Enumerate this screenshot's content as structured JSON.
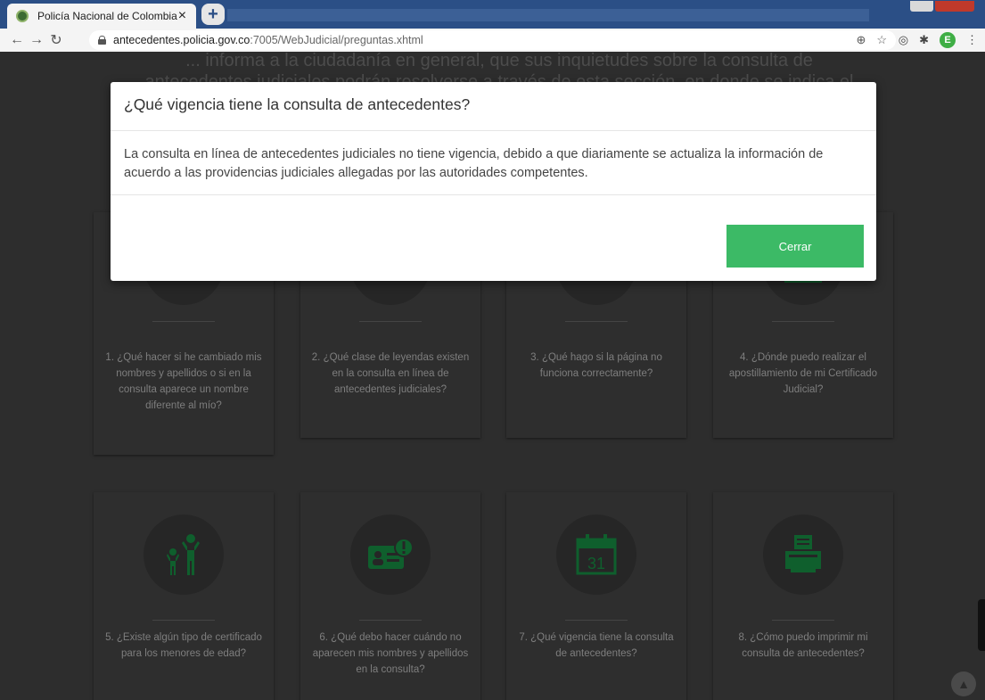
{
  "browser": {
    "tab_title": "Policía Nacional de Colombia",
    "tab_close": "×",
    "new_tab": "+",
    "url_host": "antecedentes.policia.gov.co",
    "url_path": ":7005/WebJudicial/preguntas.xhtml",
    "avatar_letter": "E"
  },
  "page": {
    "intro_text": "... informa a la ciudadanía en general, que sus inquietudes sobre la consulta de antecedentes judiciales podrán resolverse a través de esta sección, en donde se indica el",
    "cards": [
      {
        "label": "1. ¿Qué hacer si he cambiado mis nombres y apellidos o si en la consulta aparece un nombre diferente al mío?"
      },
      {
        "label": "2. ¿Qué clase de leyendas existen en la consulta en línea de antecedentes judiciales?"
      },
      {
        "label": "3. ¿Qué hago si la página no funciona correctamente?"
      },
      {
        "label": "4. ¿Dónde puedo realizar el apostillamiento de mi Certificado Judicial?"
      },
      {
        "label": "5. ¿Existe algún tipo de certificado para los menores de edad?"
      },
      {
        "label": "6. ¿Qué debo hacer cuándo no aparecen mis nombres y apellidos en la consulta?"
      },
      {
        "label": "7. ¿Qué vigencia tiene la consulta de antecedentes?",
        "calendar_day": "31"
      },
      {
        "label": "8. ¿Cómo puedo imprimir mi consulta de antecedentes?"
      }
    ]
  },
  "modal": {
    "title": "¿Qué vigencia tiene la consulta de antecedentes?",
    "body": "La consulta en línea de antecedentes judiciales no tiene vigencia, debido a que diariamente se actualiza la información de acuerdo a las providencias judiciales allegadas por las autoridades competentes.",
    "close_label": "Cerrar"
  },
  "colors": {
    "accent": "#3cba66",
    "browser_frame": "#2b4f86",
    "icon_green": "#0f5f2d"
  }
}
